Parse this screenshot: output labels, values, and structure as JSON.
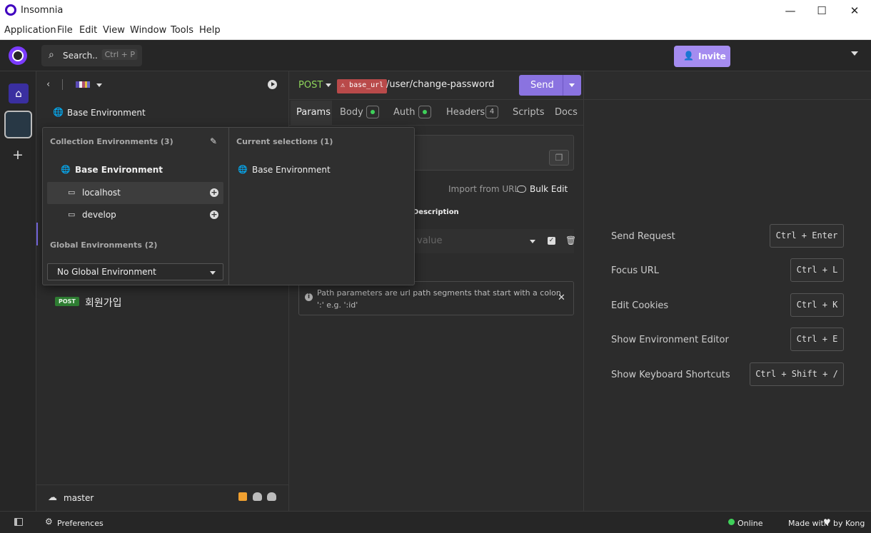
{
  "window": {
    "title": "Insomnia",
    "minimize": "—",
    "maximize": "☐",
    "close": "✕"
  },
  "menu": [
    "Application",
    "File",
    "Edit",
    "View",
    "Window",
    "Tools",
    "Help"
  ],
  "header": {
    "search_label": "Search..",
    "search_shortcut": "Ctrl + P",
    "invite_label": "Invite"
  },
  "sidebar": {
    "environment_label": "Base Environment",
    "request": {
      "method_badge": "POST",
      "name": "회원가입"
    },
    "branch": "master"
  },
  "env_dropdown": {
    "collection_heading": "Collection Environments (3)",
    "collection_items": [
      {
        "label": "Base Environment"
      },
      {
        "label": "localhost"
      },
      {
        "label": "develop"
      }
    ],
    "global_heading": "Global Environments (2)",
    "global_select_value": "No Global Environment",
    "current_heading": "Current selections (1)",
    "current_items": [
      {
        "label": "Base Environment"
      }
    ]
  },
  "request": {
    "method": "POST",
    "url_tag": "base_url",
    "url_path": "/user/change-password",
    "send_label": "Send",
    "tabs": {
      "params": "Params",
      "body": "Body",
      "auth": "Auth",
      "headers": "Headers",
      "headers_count": "4",
      "scripts": "Scripts",
      "docs": "Docs"
    },
    "import_from_url": "Import from URL",
    "bulk_edit": "Bulk Edit",
    "description_header": "Description",
    "param_value_placeholder": "value",
    "info_line1": "Path parameters are url path segments that start with a colon",
    "info_line2": "':' e.g. ':id'"
  },
  "shortcuts": [
    {
      "label": "Send Request",
      "key": "Ctrl + Enter"
    },
    {
      "label": "Focus URL",
      "key": "Ctrl + L"
    },
    {
      "label": "Edit Cookies",
      "key": "Ctrl + K"
    },
    {
      "label": "Show Environment Editor",
      "key": "Ctrl + E"
    },
    {
      "label": "Show Keyboard Shortcuts",
      "key": "Ctrl + Shift + /"
    }
  ],
  "status": {
    "preferences": "Preferences",
    "online": "Online",
    "made_with": "Made with",
    "by_kong": "by Kong"
  },
  "colors": {
    "accent": "#7b3bff",
    "send_button": "#8a73e0",
    "invite_button": "#a58cf0",
    "method_post": "#8fd45b",
    "online": "#3fd05a",
    "url_tag_error": "#b94a4a"
  }
}
